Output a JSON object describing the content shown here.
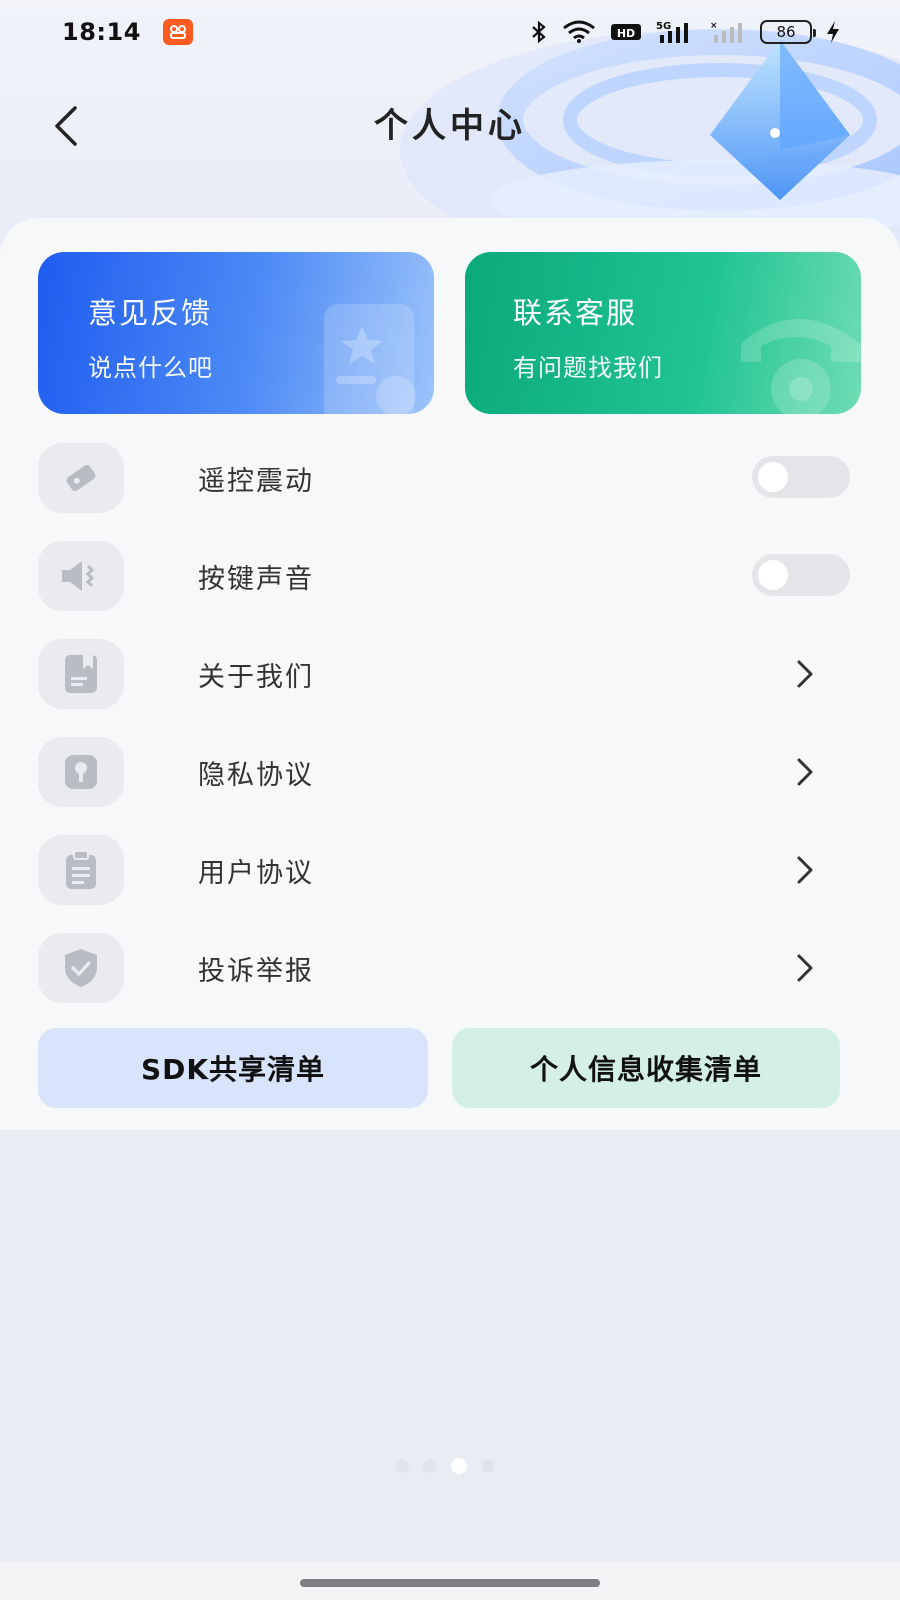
{
  "status_bar": {
    "time": "18:14",
    "battery_percent": "86",
    "icons": [
      "bluetooth-icon",
      "wifi-icon",
      "hd-icon",
      "5g-signal-icon",
      "signal-icon",
      "charging-icon"
    ]
  },
  "nav": {
    "title": "个人中心"
  },
  "promo_cards": {
    "feedback": {
      "title": "意见反馈",
      "subtitle": "说点什么吧",
      "color": "#1f5cf0"
    },
    "service": {
      "title": "联系客服",
      "subtitle": "有问题找我们",
      "color": "#0aa97a"
    }
  },
  "settings": {
    "items": [
      {
        "label": "遥控震动",
        "control": "toggle",
        "on": false,
        "icon": "vibration-icon"
      },
      {
        "label": "按键声音",
        "control": "toggle",
        "on": false,
        "icon": "speaker-icon"
      },
      {
        "label": "关于我们",
        "control": "chevron",
        "icon": "bookmark-doc-icon"
      },
      {
        "label": "隐私协议",
        "control": "chevron",
        "icon": "lock-key-icon"
      },
      {
        "label": "用户协议",
        "control": "chevron",
        "icon": "clipboard-icon"
      },
      {
        "label": "投诉举报",
        "control": "chevron",
        "icon": "shield-check-icon"
      }
    ]
  },
  "bottom_buttons": {
    "sdk": "SDK共享清单",
    "info": "个人信息收集清单"
  },
  "pager": {
    "count": 4,
    "active_index": 2
  }
}
